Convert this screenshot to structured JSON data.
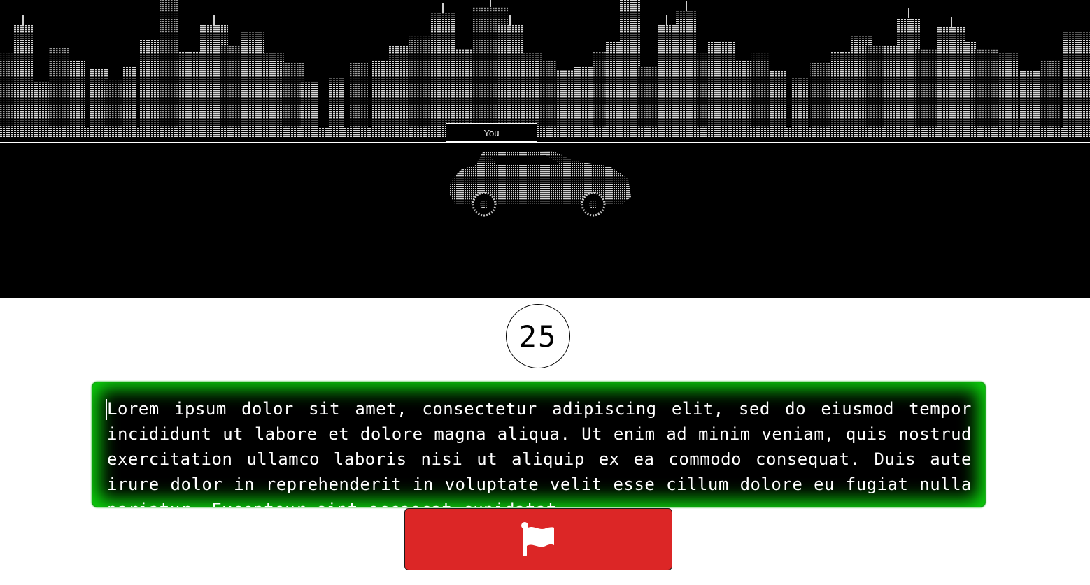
{
  "race": {
    "player_label": "You"
  },
  "timer": {
    "value": "25"
  },
  "passage": {
    "text": "Lorem ipsum dolor sit amet, consectetur adipiscing elit, sed do eiusmod tempor incididunt ut labore et dolore magna aliqua. Ut enim ad minim veniam, quis nostrud exercitation ullamco laboris nisi ut aliquip ex ea commodo consequat. Duis aute irure dolor in reprehenderit in voluptate velit esse cillum dolore eu fugiat nulla pariatur. Excepteur sint occaecat cupidatat"
  },
  "controls": {
    "give_up_icon": "flag-icon"
  },
  "colors": {
    "scene_background": "#000000",
    "text_box_glow": "#0cd60c",
    "give_up_button": "#dc2626"
  }
}
